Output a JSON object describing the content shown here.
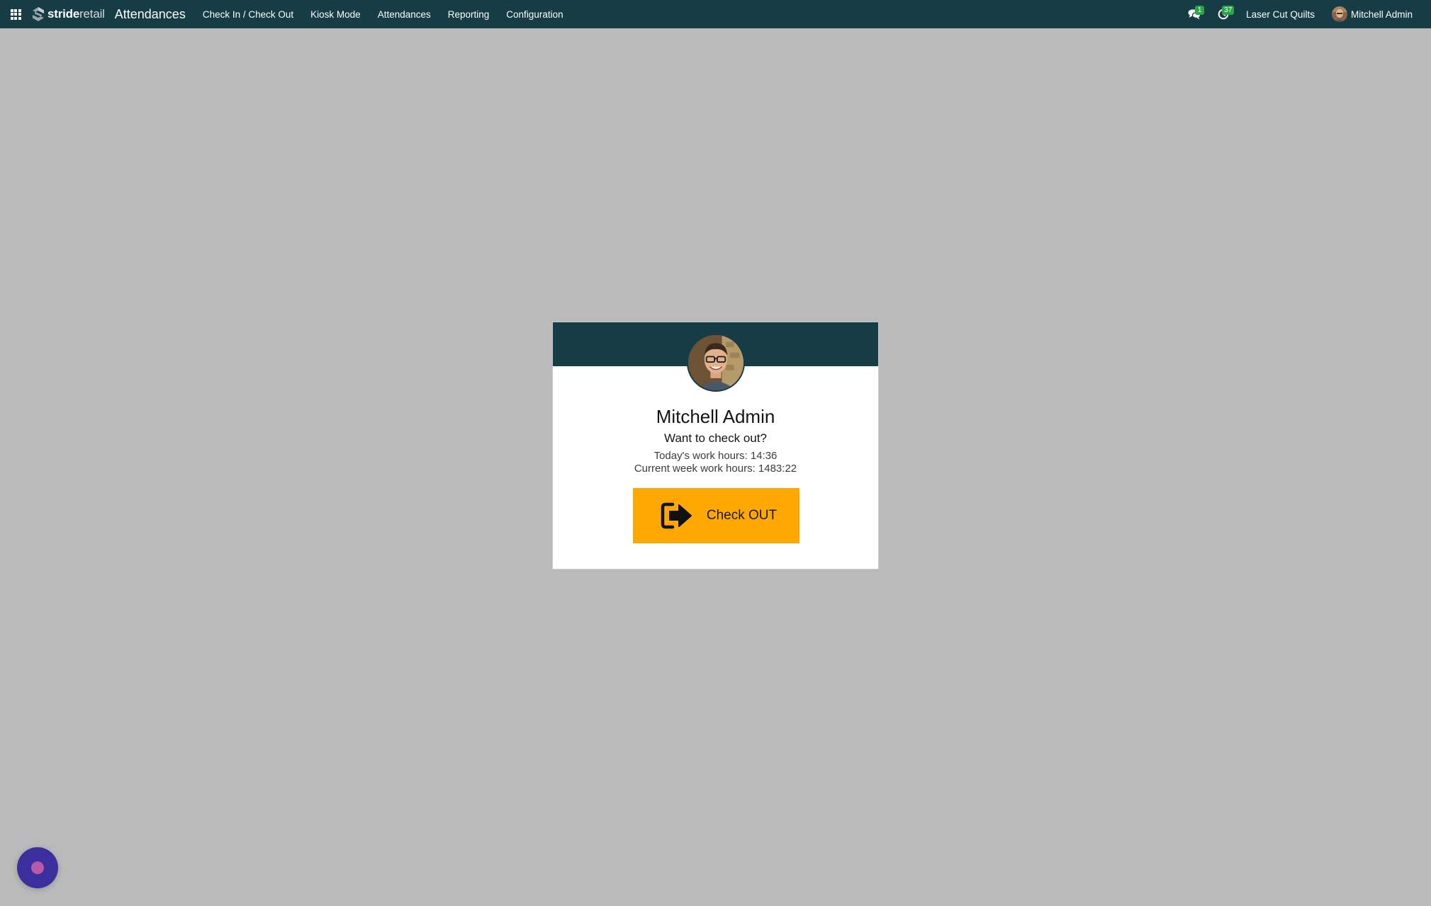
{
  "navbar": {
    "brand": {
      "part1": "stride",
      "part2": "retail"
    },
    "app_name": "Attendances",
    "menu": [
      {
        "label": "Check In / Check Out"
      },
      {
        "label": "Kiosk Mode"
      },
      {
        "label": "Attendances"
      },
      {
        "label": "Reporting"
      },
      {
        "label": "Configuration"
      }
    ],
    "messages_count": "1",
    "activities_count": "37",
    "company": "Laser Cut Quilts",
    "user_name": "Mitchell Admin"
  },
  "kiosk": {
    "employee_name": "Mitchell Admin",
    "question": "Want to check out?",
    "today_hours": "Today's work hours: 14:36",
    "week_hours": "Current week work hours: 1483:22",
    "button_label": "Check OUT"
  },
  "colors": {
    "navbar": "#163c46",
    "background": "#b9bab9",
    "checkout_button": "#ffa802",
    "badge": "#28a745",
    "chat_bubble": "#3b2f9e"
  }
}
